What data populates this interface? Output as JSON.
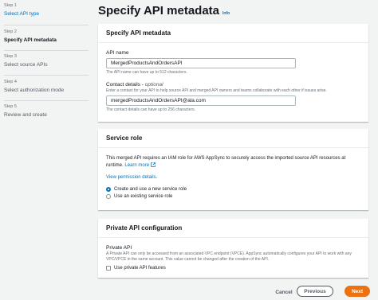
{
  "sidebar": {
    "steps": [
      {
        "num": "Step 1",
        "label": "Select API type"
      },
      {
        "num": "Step 2",
        "label": "Specify API metadata"
      },
      {
        "num": "Step 3",
        "label": "Select source APIs"
      },
      {
        "num": "Step 4",
        "label": "Select authorization mode"
      },
      {
        "num": "Step 5",
        "label": "Review and create"
      }
    ]
  },
  "page": {
    "title": "Specify API metadata",
    "info": "Info"
  },
  "metadata": {
    "title": "Specify API metadata",
    "api_name_label": "API name",
    "api_name_value": "MergedProductsAndOrdersAPI",
    "api_name_hint": "The API name can have up to 512 characters.",
    "contact_label": "Contact details - ",
    "contact_optional": "optional",
    "contact_desc": "Enter a contact for your API to help source API and merged API owners and teams collaborate with each other if issues arise.",
    "contact_value": "mergedProductsAndOrdersAPI@ala.com",
    "contact_hint": "The contact details can have up to 256 characters."
  },
  "service_role": {
    "title": "Service role",
    "text": "This merged API requires an IAM role for AWS AppSync to securely access the imported source API resources at runtime.",
    "learn_more": "Learn more",
    "view_permission": "View permission details.",
    "option_create": "Create and use a new service role",
    "option_existing": "Use an existing service role"
  },
  "private_api": {
    "title": "Private API configuration",
    "label": "Private API",
    "desc": "A Private API can only be accessed from an associated VPC endpoint (VPCE). AppSync automatically configures your API to work with any VPC/VPCE in the same account. This value cannot be changed after the creation of the API.",
    "checkbox_label": "Use private API features"
  },
  "footer": {
    "cancel": "Cancel",
    "previous": "Previous",
    "next": "Next"
  },
  "colors": {
    "accent": "#0073bb",
    "primary_button": "#ec7211"
  }
}
